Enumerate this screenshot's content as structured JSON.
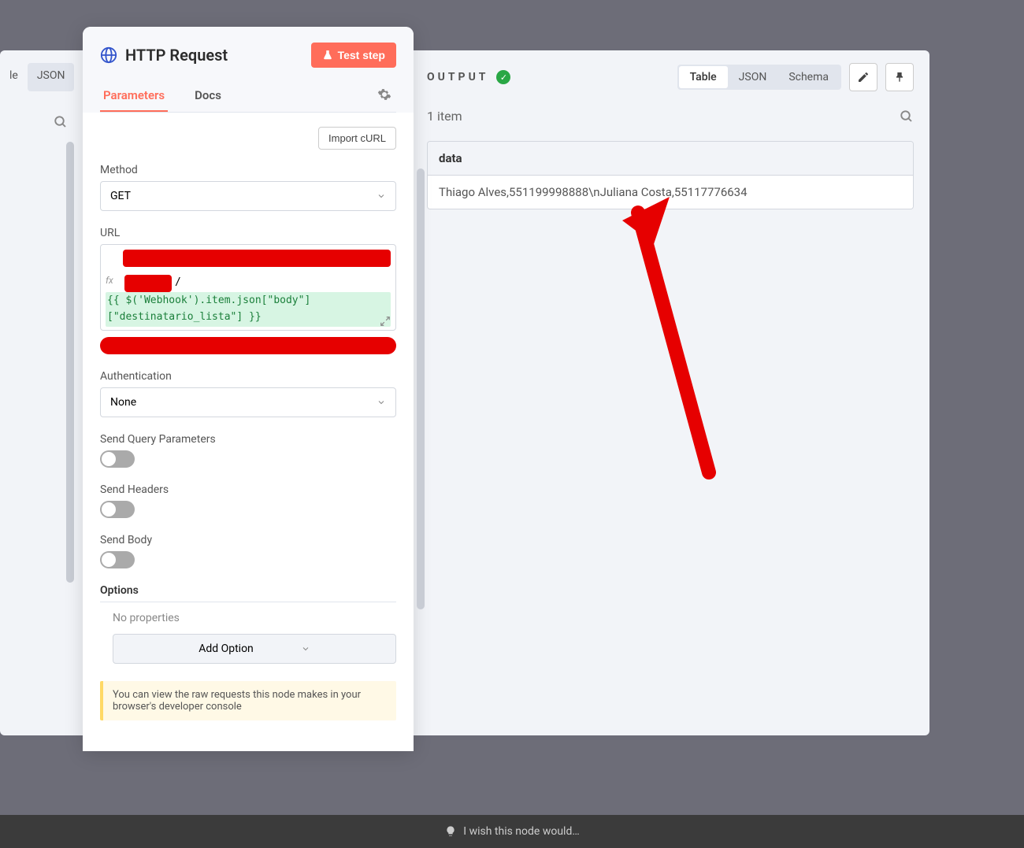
{
  "left_tabs_behind": {
    "label_json": "JSON",
    "label_le": "le"
  },
  "panel": {
    "title": "HTTP Request",
    "test_button": "Test step",
    "tabs": {
      "parameters": "Parameters",
      "docs": "Docs"
    },
    "import_curl": "Import cURL",
    "method": {
      "label": "Method",
      "value": "GET"
    },
    "url": {
      "label": "URL",
      "expression": "{{ $('Webhook').item.json[\"body\"][\"destinatario_lista\"] }}",
      "fx": "fx"
    },
    "authentication": {
      "label": "Authentication",
      "value": "None"
    },
    "send_query": {
      "label": "Send Query Parameters"
    },
    "send_headers": {
      "label": "Send Headers"
    },
    "send_body": {
      "label": "Send Body"
    },
    "options": {
      "label": "Options",
      "no_properties": "No properties",
      "add_option": "Add Option"
    },
    "info_note": "You can view the raw requests this node makes in your browser's developer console"
  },
  "output": {
    "title": "OUTPUT",
    "view_tabs": {
      "table": "Table",
      "json": "JSON",
      "schema": "Schema"
    },
    "item_count": "1 item",
    "column_header": "data",
    "row_value": "Thiago Alves,551199998888\\nJuliana Costa,55117776634"
  },
  "footer": {
    "hint": "I wish this node would…"
  }
}
